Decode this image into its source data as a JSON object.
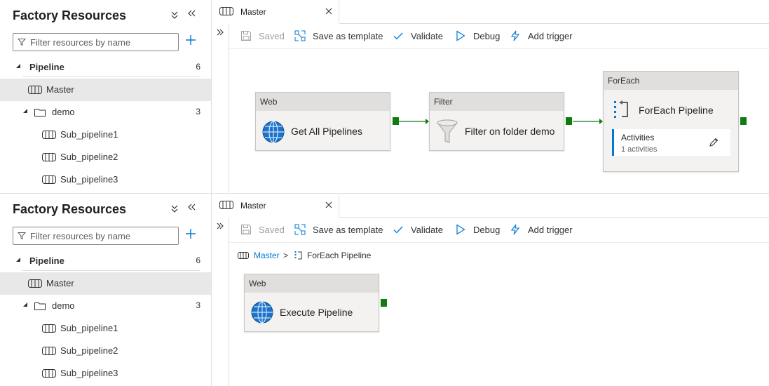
{
  "panels": [
    {
      "sidebar": {
        "title": "Factory Resources",
        "filter_placeholder": "Filter resources by name",
        "pipeline_label": "Pipeline",
        "pipeline_count": "6",
        "items": [
          {
            "label": "Master"
          },
          {
            "label": "demo",
            "count": "3"
          },
          {
            "label": "Sub_pipeline1"
          },
          {
            "label": "Sub_pipeline2"
          },
          {
            "label": "Sub_pipeline3"
          }
        ]
      },
      "tab": {
        "label": "Master"
      },
      "toolbar": {
        "saved": "Saved",
        "save_template": "Save as template",
        "validate": "Validate",
        "debug": "Debug",
        "add_trigger": "Add trigger"
      },
      "activities": [
        {
          "type": "Web",
          "name": "Get All Pipelines",
          "icon": "globe-icon"
        },
        {
          "type": "Filter",
          "name": "Filter on folder demo",
          "icon": "funnel-icon"
        },
        {
          "type": "ForEach",
          "name": "ForEach Pipeline",
          "icon": "foreach-icon",
          "sub_label": "Activities",
          "sub_count": "1 activities"
        }
      ]
    },
    {
      "sidebar": {
        "title": "Factory Resources",
        "filter_placeholder": "Filter resources by name",
        "pipeline_label": "Pipeline",
        "pipeline_count": "6",
        "items": [
          {
            "label": "Master"
          },
          {
            "label": "demo",
            "count": "3"
          },
          {
            "label": "Sub_pipeline1"
          },
          {
            "label": "Sub_pipeline2"
          },
          {
            "label": "Sub_pipeline3"
          }
        ]
      },
      "tab": {
        "label": "Master"
      },
      "toolbar": {
        "saved": "Saved",
        "save_template": "Save as template",
        "validate": "Validate",
        "debug": "Debug",
        "add_trigger": "Add trigger"
      },
      "breadcrumb": {
        "root": "Master",
        "separator": ">",
        "current": "ForEach Pipeline"
      },
      "activities": [
        {
          "type": "Web",
          "name": "Execute Pipeline",
          "icon": "globe-icon"
        }
      ]
    }
  ],
  "colors": {
    "accent": "#0078d4",
    "success_port": "#107c10",
    "selected_row": "#e8e8e8",
    "activity_header": "#e1dfdd",
    "activity_body": "#f3f2f1"
  }
}
